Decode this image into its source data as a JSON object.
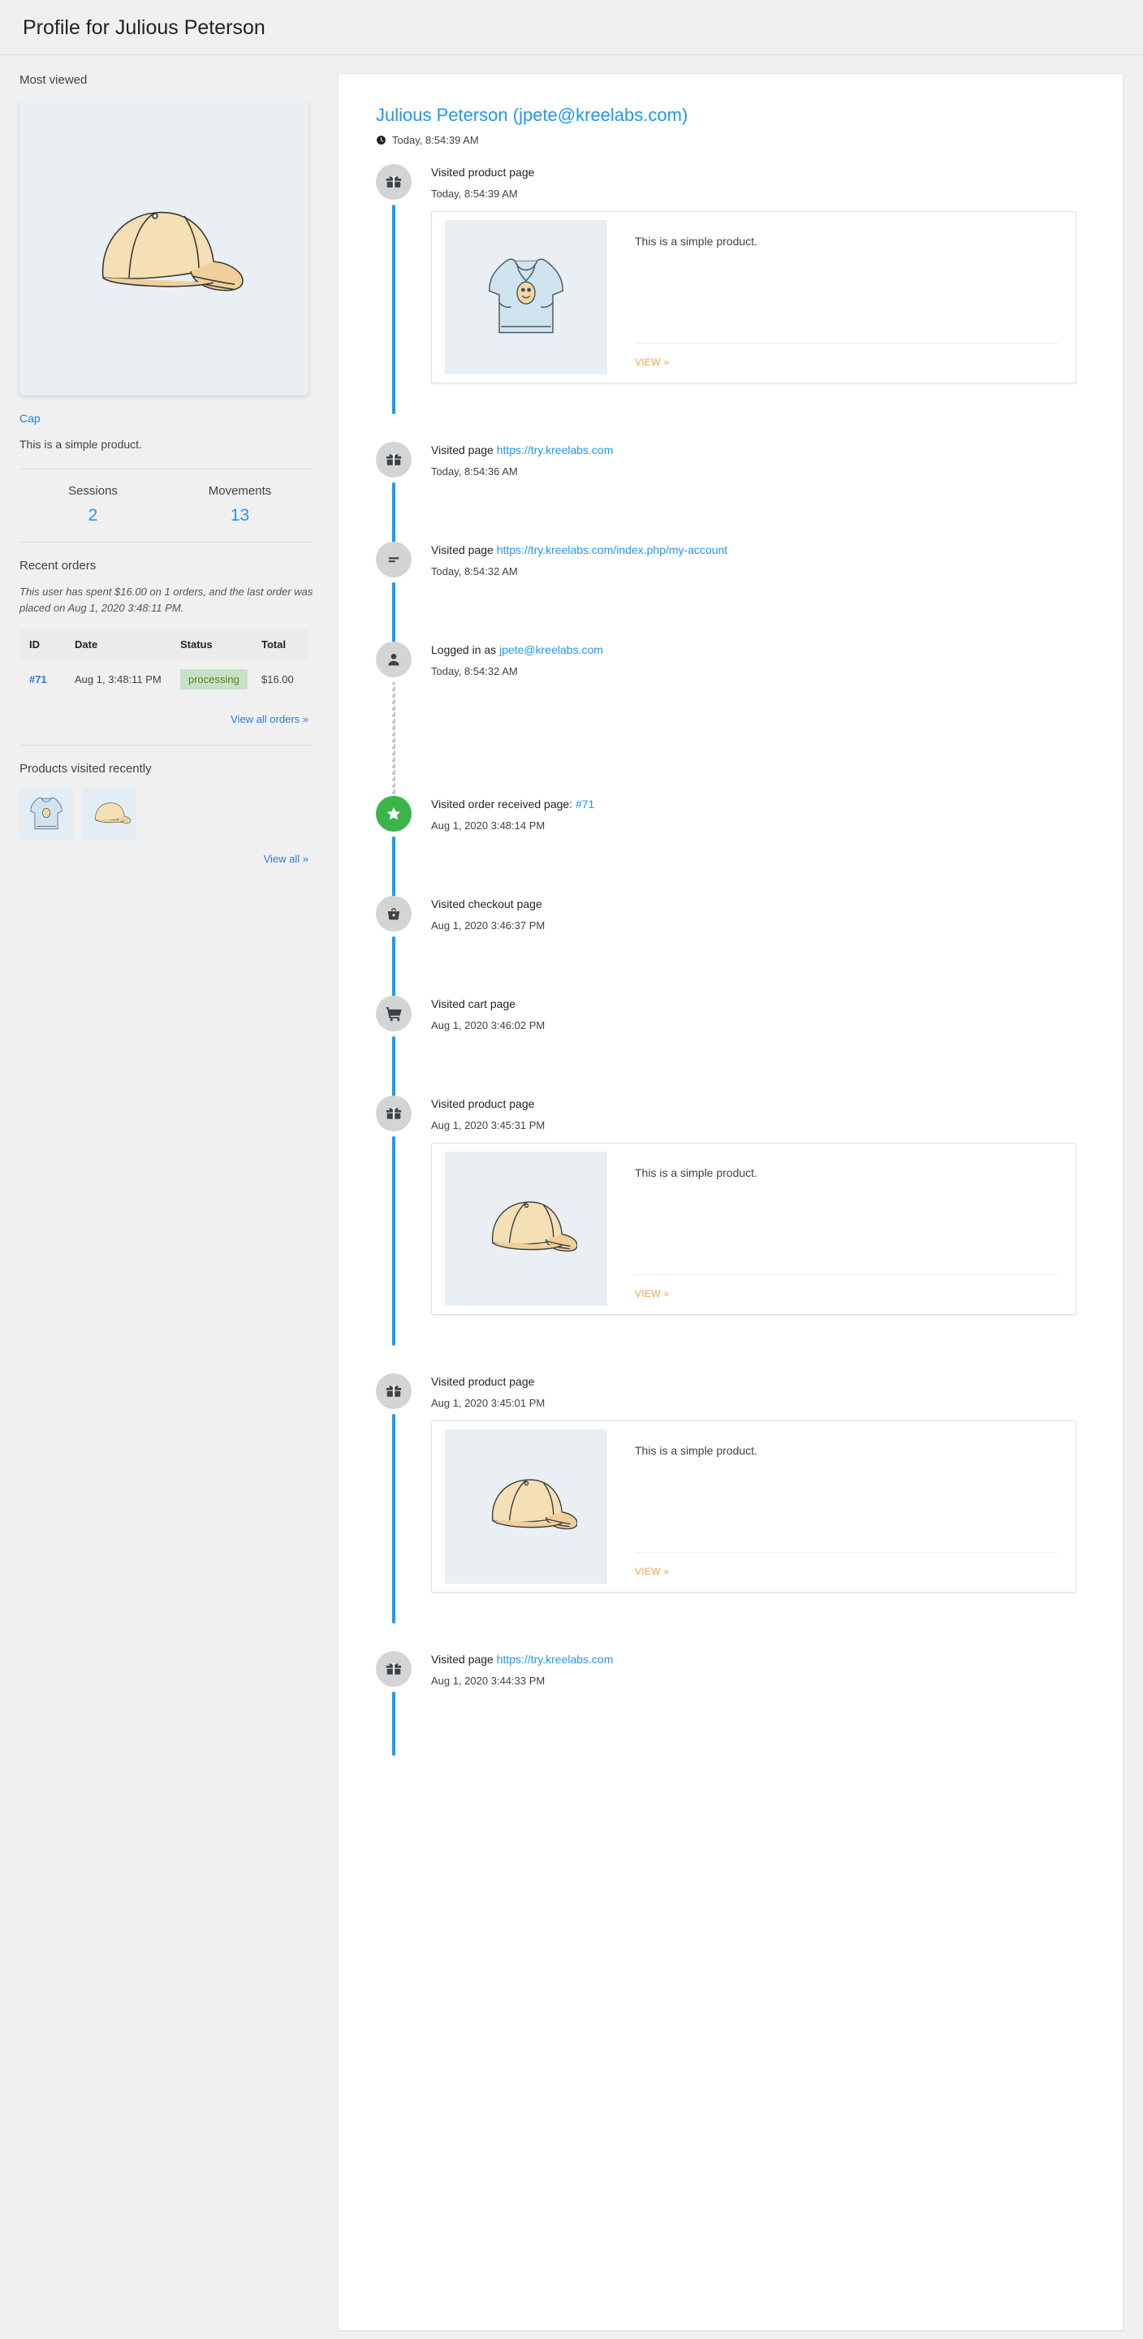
{
  "header": {
    "title": "Profile for Julious Peterson"
  },
  "sidebar": {
    "most_viewed_heading": "Most viewed",
    "hero": {
      "product_name": "Cap",
      "description": "This is a simple product.",
      "image_icon": "cap-image"
    },
    "stats": [
      {
        "label": "Sessions",
        "value": "2"
      },
      {
        "label": "Movements",
        "value": "13"
      }
    ],
    "recent_orders": {
      "heading": "Recent orders",
      "note": "This user has spent $16.00 on 1 orders, and the last order was placed on Aug 1, 2020 3:48:11 PM.",
      "columns": [
        "ID",
        "Date",
        "Status",
        "Total"
      ],
      "rows": [
        {
          "id": "#71",
          "date": "Aug 1, 3:48:11 PM",
          "status": "processing",
          "total": "$16.00"
        }
      ],
      "view_all_label": "View all orders »"
    },
    "recent_products": {
      "heading": "Products visited recently",
      "items": [
        {
          "image_icon": "hoodie-image"
        },
        {
          "image_icon": "cap-image"
        }
      ],
      "view_all_label": "View all »"
    }
  },
  "main": {
    "profile_link": "Julious Peterson (jpete@kreelabs.com)",
    "profile_time": "Today, 8:54:39 AM",
    "clock_icon": "clock-icon",
    "timeline": [
      {
        "icon": "gift-icon",
        "badge_color": "#d4d4d4",
        "title": "Visited product page",
        "link_text": "",
        "date": "Today, 8:54:39 AM",
        "line_style": "solid",
        "card": {
          "image_icon": "hoodie-image",
          "desc": "This is a simple product.",
          "view_label": "VIEW »"
        }
      },
      {
        "icon": "gift-icon",
        "badge_color": "#d4d4d4",
        "title": "Visited page",
        "link_text": "https://try.kreelabs.com",
        "date": "Today, 8:54:36 AM",
        "line_style": "solid",
        "card": null
      },
      {
        "icon": "lines-icon",
        "badge_color": "#d4d4d4",
        "title": "Visited page",
        "link_text": "https://try.kreelabs.com/index.php/my-account",
        "date": "Today, 8:54:32 AM",
        "line_style": "solid",
        "card": null
      },
      {
        "icon": "person-icon",
        "badge_color": "#d4d4d4",
        "title": "Logged in as",
        "link_text": "jpete@kreelabs.com",
        "date": "Today, 8:54:32 AM",
        "line_style": "dotted",
        "card": null
      },
      {
        "icon": "star-icon",
        "badge_color": "#3ab54a",
        "title": "Visited order received page:",
        "link_text": "#71",
        "date": "Aug 1, 2020 3:48:14 PM",
        "line_style": "solid",
        "card": null
      },
      {
        "icon": "basket-icon",
        "badge_color": "#d4d4d4",
        "title": "Visited checkout page",
        "link_text": "",
        "date": "Aug 1, 2020 3:46:37 PM",
        "line_style": "solid",
        "card": null
      },
      {
        "icon": "cart-icon",
        "badge_color": "#d4d4d4",
        "title": "Visited cart page",
        "link_text": "",
        "date": "Aug 1, 2020 3:46:02 PM",
        "line_style": "solid",
        "card": null
      },
      {
        "icon": "gift-icon",
        "badge_color": "#d4d4d4",
        "title": "Visited product page",
        "link_text": "",
        "date": "Aug 1, 2020 3:45:31 PM",
        "line_style": "solid",
        "card": {
          "image_icon": "cap-image",
          "desc": "This is a simple product.",
          "view_label": "VIEW »"
        }
      },
      {
        "icon": "gift-icon",
        "badge_color": "#d4d4d4",
        "title": "Visited product page",
        "link_text": "",
        "date": "Aug 1, 2020 3:45:01 PM",
        "line_style": "solid",
        "card": {
          "image_icon": "cap-image",
          "desc": "This is a simple product.",
          "view_label": "VIEW »"
        }
      },
      {
        "icon": "gift-icon",
        "badge_color": "#d4d4d4",
        "title": "Visited page",
        "link_text": "https://try.kreelabs.com",
        "date": "Aug 1, 2020 3:44:33 PM",
        "line_style": "solid",
        "card": null
      }
    ]
  },
  "colors": {
    "accent_blue": "#2196f3",
    "link_blue": "#2a7ade",
    "timeline_line": "#1e9cf0",
    "green_badge": "#3ab54a",
    "status_bg": "#c6e1c6",
    "status_text": "#5b841b",
    "view_orange": "#f0a24a"
  }
}
